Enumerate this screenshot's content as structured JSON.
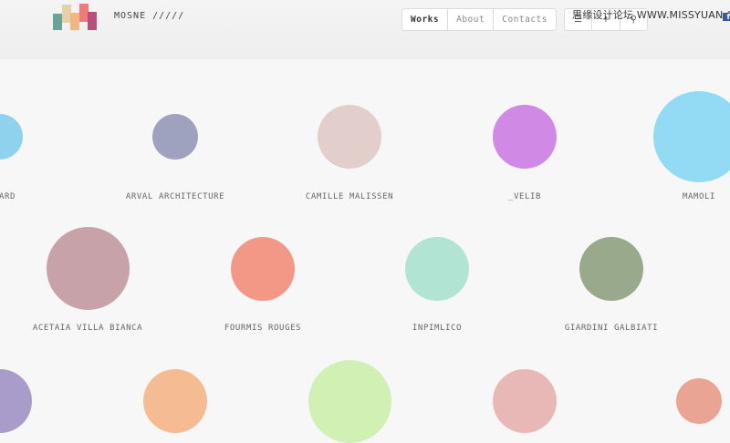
{
  "brand": {
    "name": "MOSNE /////"
  },
  "nav": {
    "items": [
      {
        "label": "Works",
        "active": true
      },
      {
        "label": "About",
        "active": false
      },
      {
        "label": "Contacts",
        "active": false
      }
    ]
  },
  "tools": [
    {
      "icon": "menu-icon",
      "glyph": "☰"
    },
    {
      "icon": "plus-icon",
      "glyph": "+"
    },
    {
      "icon": "search-icon",
      "glyph": "⚲"
    }
  ],
  "watermark": "思缘设计论坛 WWW.MISSYUAN.COM",
  "projects": [
    {
      "label": "ARD",
      "color": "#8fd2ee"
    },
    {
      "label": "ARVAL ARCHITECTURE",
      "color": "#9fa2be"
    },
    {
      "label": "CAMILLE MALISSEN",
      "color": "#e2cecb"
    },
    {
      "label": "_VELIB",
      "color": "#d08ae6"
    },
    {
      "label": "MAMOLI",
      "color": "#93daf5"
    },
    {
      "label": "ACETAIA VILLA BIANCA",
      "color": "#c7a2a8"
    },
    {
      "label": "FOURMIS ROUGES",
      "color": "#f39887"
    },
    {
      "label": "INPIMLICO",
      "color": "#b2e4d4"
    },
    {
      "label": "GIARDINI GALBIATI",
      "color": "#98a98c"
    },
    {
      "label": "",
      "color": "#a99ccb"
    },
    {
      "label": "",
      "color": "#f5bc94"
    },
    {
      "label": "",
      "color": "#d0f0b4"
    },
    {
      "label": "",
      "color": "#e8b8b6"
    },
    {
      "label": "",
      "color": "#e9a494"
    }
  ]
}
